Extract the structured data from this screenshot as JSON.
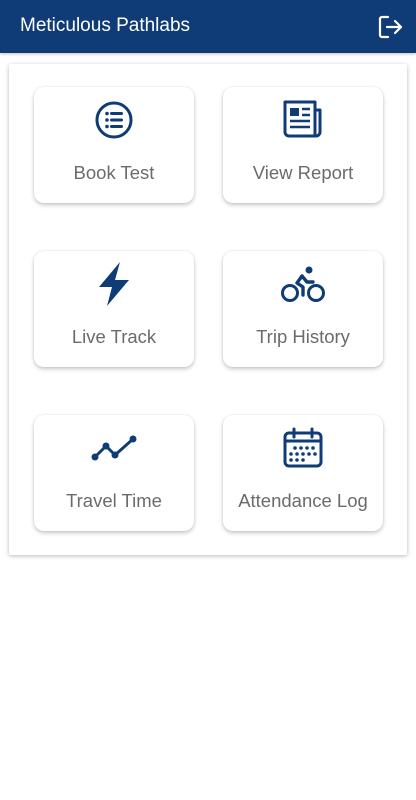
{
  "app_bar": {
    "title": "Meticulous Pathlabs",
    "logout_icon": "logout-icon"
  },
  "menu": [
    {
      "label": "Book Test",
      "icon": "list-icon"
    },
    {
      "label": "View Report",
      "icon": "newspaper-icon"
    },
    {
      "label": "Live Track",
      "icon": "lightning-icon"
    },
    {
      "label": "Trip History",
      "icon": "bicycle-icon"
    },
    {
      "label": "Travel Time",
      "icon": "line-chart-icon"
    },
    {
      "label": "Attendance Log",
      "icon": "calendar-icon"
    }
  ],
  "colors": {
    "primary": "#0f3c76",
    "label_text": "#6b6b6b",
    "background": "#ffffff"
  }
}
